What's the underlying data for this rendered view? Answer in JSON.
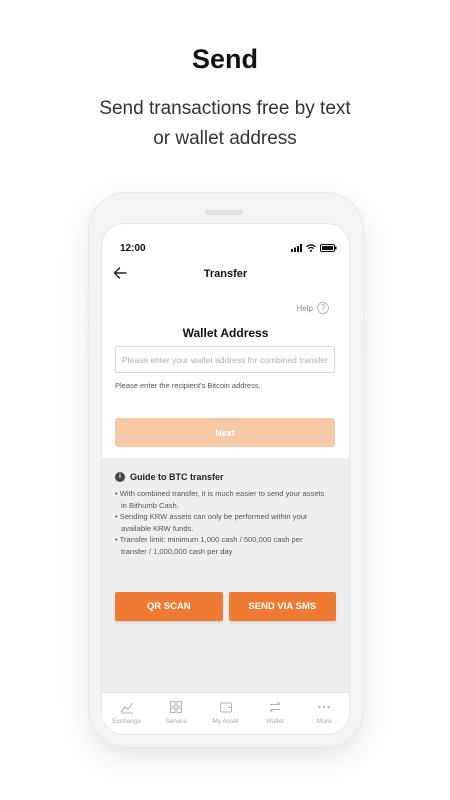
{
  "promo": {
    "title": "Send",
    "subtitle_line1": "Send transactions free by text",
    "subtitle_line2": "or wallet address"
  },
  "status_bar": {
    "time": "12:00"
  },
  "header": {
    "title": "Transfer"
  },
  "help": {
    "label": "Help",
    "icon": "?"
  },
  "wallet": {
    "label": "Wallet Address",
    "placeholder": "Please enter your wallet address for combined transfer",
    "value": "",
    "hint": "Please enter the recipient's Bitcoin address."
  },
  "next_button": {
    "label": "Next"
  },
  "guide": {
    "title": "Guide to BTC transfer",
    "items": [
      "• With combined transfer, it is much easier to send your assets",
      "  in Bithumb Cash.",
      "• Sending KRW assets can only be performed within your",
      "  available KRW funds.",
      "• Transfer limit: minimum 1,000 cash / 500,000 cash per",
      "  transfer / 1,000,000 cash per day"
    ]
  },
  "actions": {
    "qr_scan": "QR SCAN",
    "send_sms": "SEND VIA SMS"
  },
  "tabs": [
    {
      "label": "Exchange",
      "icon": "chart-icon"
    },
    {
      "label": "Service",
      "icon": "grid-icon"
    },
    {
      "label": "My Asset",
      "icon": "wallet-icon"
    },
    {
      "label": "Wallet",
      "icon": "transfer-icon"
    },
    {
      "label": "More",
      "icon": "more-icon"
    }
  ],
  "colors": {
    "accent": "#ee7a33",
    "accent_disabled": "#f5c8a6",
    "guide_bg": "#eeeff1"
  }
}
